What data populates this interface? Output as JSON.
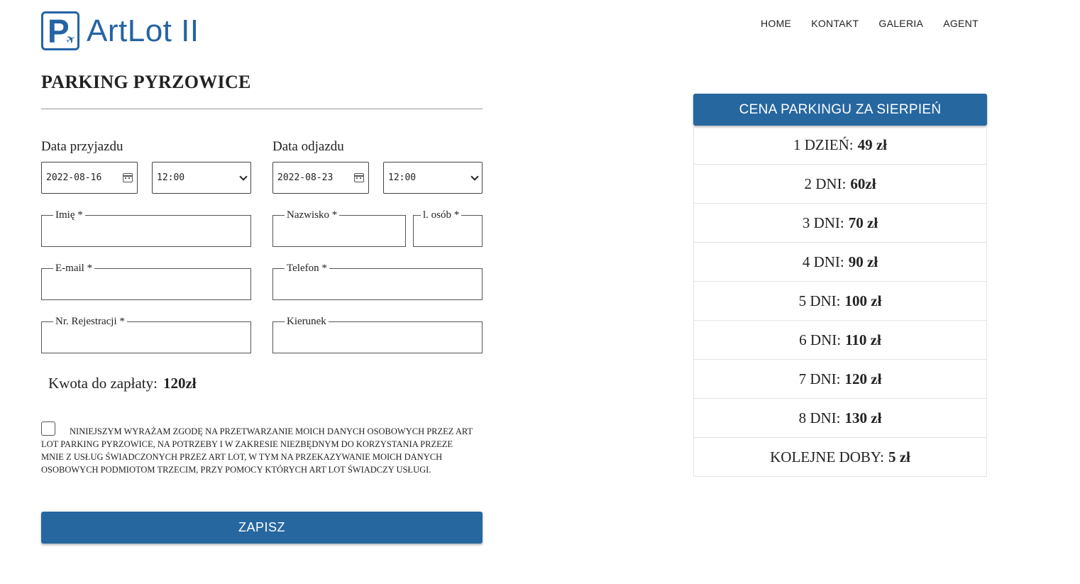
{
  "brand": {
    "logo_letter": "P",
    "logo_text": "ArtLot II",
    "brand_color": "#2563a4"
  },
  "nav": [
    "HOME",
    "KONTAKT",
    "GALERIA",
    "AGENT"
  ],
  "page_title": "PARKING PYRZOWICE",
  "arrival": {
    "label": "Data  przyjazdu",
    "date": "2022-08-16",
    "time": "12:00"
  },
  "departure": {
    "label": "Data odjazdu",
    "date": "2022-08-23",
    "time": "12:00"
  },
  "fields": {
    "first_name": "Imię *",
    "last_name": "Nazwisko *",
    "persons": "l. osób *",
    "email": "E-mail *",
    "phone": "Telefon *",
    "registration": "Nr. Rejestracji *",
    "direction": "Kierunek"
  },
  "amount": {
    "label": "Kwota do zapłaty:",
    "value": "120zł"
  },
  "consent_text": "NINIEJSZYM WYRAŻAM ZGODĘ NA PRZETWARZANIE MOICH DANYCH OSOBOWYCH PRZEZ ART LOT PARKING PYRZOWICE, NA POTRZEBY I W ZAKRESIE NIEZBĘDNYM DO KORZYSTANIA PRZEZE MNIE Z USŁUG ŚWIADCZONYCH PRZEZ ART LOT, W TYM NA PRZEKAZYWANIE MOICH DANYCH OSOBOWYCH PODMIOTOM TRZECIM, PRZY POMOCY KTÓRYCH ART LOT ŚWIADCZY USŁUGI.",
  "consent_checked": false,
  "save_label": "ZAPISZ",
  "accent_color": "#2667a0",
  "pricing": {
    "title": "CENA PARKINGU ZA SIERPIEŃ",
    "rows": [
      {
        "label": "1 DZIEŃ:",
        "price": "49 zł"
      },
      {
        "label": "2 DNI:",
        "price": "60zł"
      },
      {
        "label": "3 DNI:",
        "price": "70 zł"
      },
      {
        "label": "4 DNI:",
        "price": "90 zł"
      },
      {
        "label": "5 DNI:",
        "price": "100 zł"
      },
      {
        "label": "6 DNI:",
        "price": "110 zł"
      },
      {
        "label": "7 DNI:",
        "price": "120 zł"
      },
      {
        "label": "8 DNI:",
        "price": "130 zł"
      },
      {
        "label": "KOLEJNE DOBY:",
        "price": "5 zł"
      }
    ]
  }
}
